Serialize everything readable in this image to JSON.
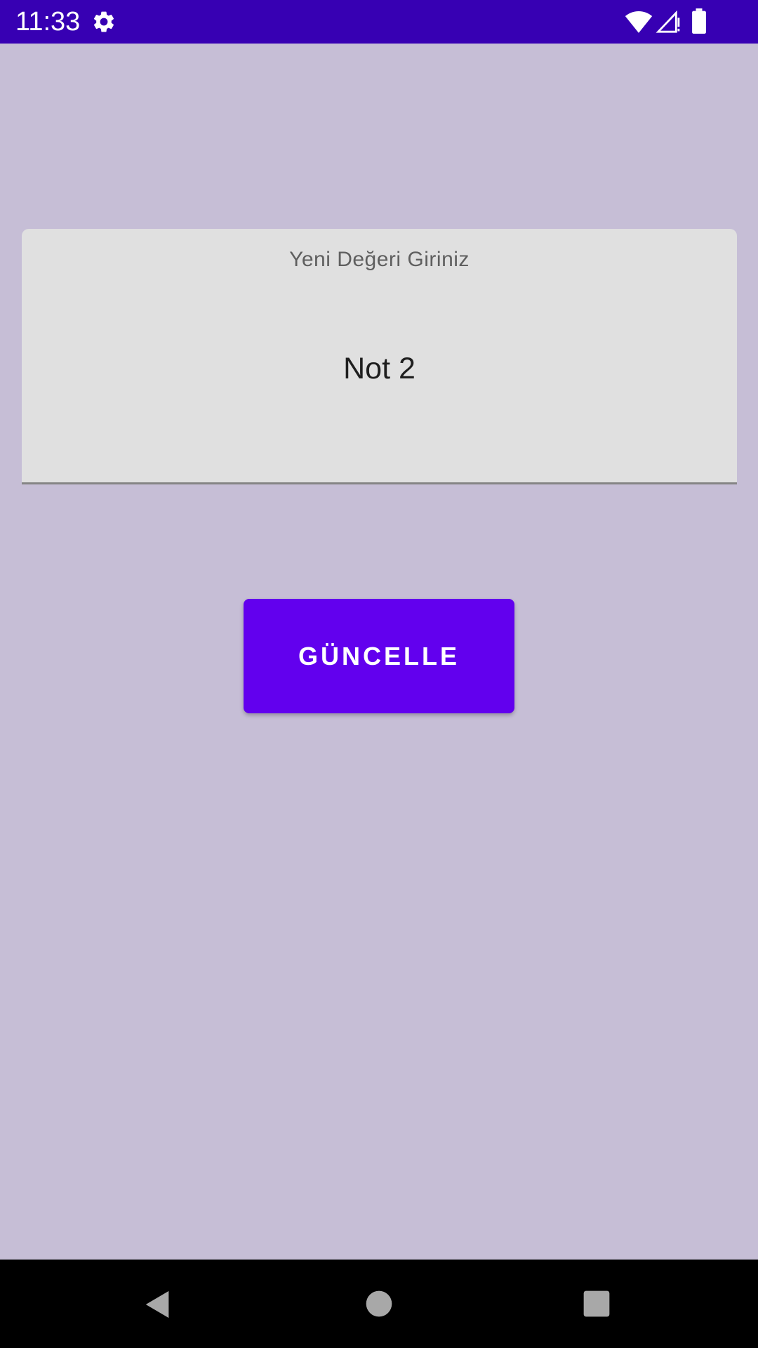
{
  "status_bar": {
    "time": "11:33",
    "icons": [
      "gear-icon",
      "wifi-icon",
      "signal-icon",
      "battery-icon"
    ],
    "background": "#3700b3"
  },
  "form": {
    "field_label": "Yeni Değeri Giriniz",
    "field_value": "Not 2"
  },
  "update_button": {
    "label": "GÜNCELLE",
    "color": "#6200ee"
  },
  "nav_bar": {
    "icons": [
      "back-icon",
      "home-icon",
      "recents-icon"
    ]
  },
  "colors": {
    "background": "#c6bed6",
    "field_background": "#e0e0e0"
  }
}
